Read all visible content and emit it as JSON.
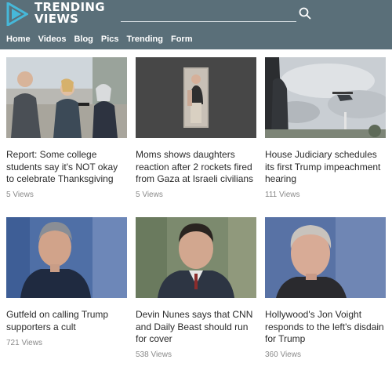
{
  "brand": {
    "line1": "TRENDING",
    "line2": "VIEWS",
    "color": "#46b8d9"
  },
  "search": {
    "value": "",
    "placeholder": ""
  },
  "nav": [
    "Home",
    "Videos",
    "Blog",
    "Pics",
    "Trending",
    "Form"
  ],
  "articles": [
    {
      "title": "Report: Some college students say it's NOT okay to celebrate Thanksgiving",
      "views": "5 Views",
      "image": "interview-outdoors"
    },
    {
      "title": "Moms shows daughters reaction after 2 rockets fired from Gaza at Israeli civilians",
      "views": "5 Views",
      "image": "vertical-video-child"
    },
    {
      "title": "House Judiciary schedules its first Trump impeachment hearing",
      "views": "111 Views",
      "image": "helicopter-sky"
    },
    {
      "title": "Gutfeld on calling Trump supporters a cult",
      "views": "721 Views",
      "image": "tv-host-portrait"
    },
    {
      "title": "Devin Nunes says that CNN and Daily Beast should run for cover",
      "views": "538 Views",
      "image": "congressman-portrait"
    },
    {
      "title": "Hollywood's Jon Voight responds to the left's disdain for Trump",
      "views": "360 Views",
      "image": "actor-portrait"
    }
  ]
}
